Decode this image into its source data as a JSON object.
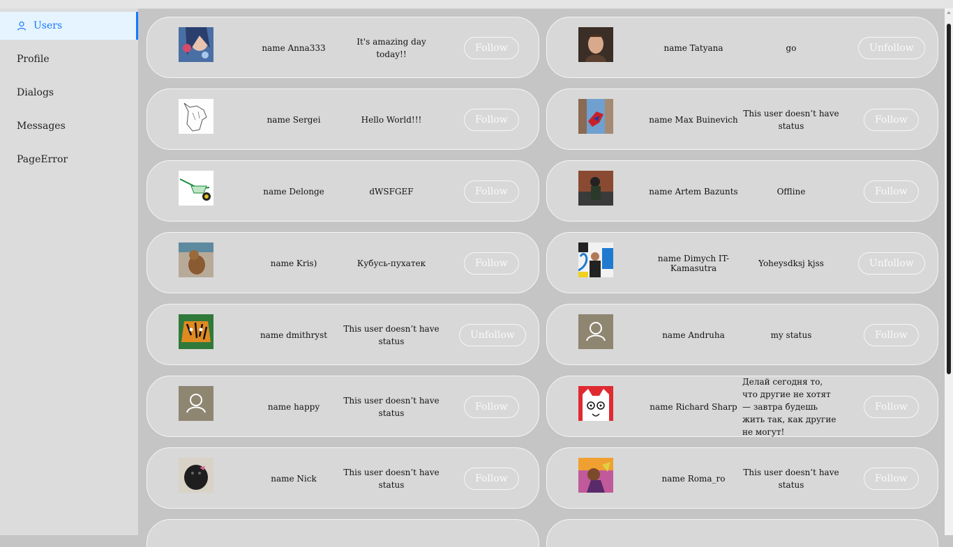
{
  "sidebar": {
    "items": [
      {
        "label": "Users",
        "active": true
      },
      {
        "label": "Profile"
      },
      {
        "label": "Dialogs"
      },
      {
        "label": "Messages"
      },
      {
        "label": "PageError"
      }
    ]
  },
  "colors": {
    "accent": "#1677ff",
    "page_bg": "#c5c5c5",
    "card_bg": "#d8d8d8",
    "placeholder_avatar": "#8f8672"
  },
  "users": [
    {
      "name": "name Anna333",
      "status": "It's amazing day today!!",
      "button": "Follow",
      "avatar": "photo-woman-art"
    },
    {
      "name": "name Tatyana",
      "status": "go",
      "button": "Unfollow",
      "avatar": "photo-woman-portrait"
    },
    {
      "name": "name Sergei",
      "status": "Hello World!!!",
      "button": "Follow",
      "avatar": "horse-sketch"
    },
    {
      "name": "name Max Buinevich",
      "status": "This user doesn’t have status",
      "button": "Follow",
      "avatar": "spiderman"
    },
    {
      "name": "name Delonge",
      "status": "dWSFGEF",
      "button": "Follow",
      "avatar": "wheelbarrow"
    },
    {
      "name": "name Artem Bazunts",
      "status": "Offline",
      "button": "Follow",
      "avatar": "photo-man-dark"
    },
    {
      "name": "name Kris)",
      "status": "Кубусь-пухатек",
      "button": "Follow",
      "avatar": "dog-beach"
    },
    {
      "name": "name Dimych IT-Kamasutra",
      "status": "Yoheysdksj kjss",
      "button": "Unfollow",
      "avatar": "speaker-man"
    },
    {
      "name": "name dmithryst",
      "status": "This user doesn’t have status",
      "button": "Unfollow",
      "avatar": "tiger"
    },
    {
      "name": "name Andruha",
      "status": "my status",
      "button": "Follow",
      "avatar": "placeholder"
    },
    {
      "name": "name happy",
      "status": "This user doesn’t have status",
      "button": "Follow",
      "avatar": "placeholder"
    },
    {
      "name": "name Richard Sharp",
      "status": "Делай сегодня то, что другие не хотят — завтра будешь жить так, как другие не могут!",
      "button": "Follow",
      "avatar": "cartoon-cat"
    },
    {
      "name": "name Nick",
      "status": "This user doesn’t have status",
      "button": "Follow",
      "avatar": "black-dog"
    },
    {
      "name": "name Roma_ro",
      "status": "This user doesn’t have status",
      "button": "Follow",
      "avatar": "art-colorful"
    }
  ]
}
